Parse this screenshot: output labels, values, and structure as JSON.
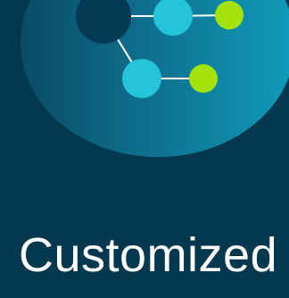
{
  "hero": {
    "headline": "Customized",
    "icon": "network-graph-icon"
  },
  "colors": {
    "background": "#03384f",
    "circle_gradient": [
      "#0a4b66",
      "#0e6f8d",
      "#119bbb"
    ],
    "node_dark": "#053a55",
    "node_teal": "#26c4d9",
    "node_lime": "#a3e20a",
    "connector": "#ffffff",
    "text": "#ffffff"
  }
}
